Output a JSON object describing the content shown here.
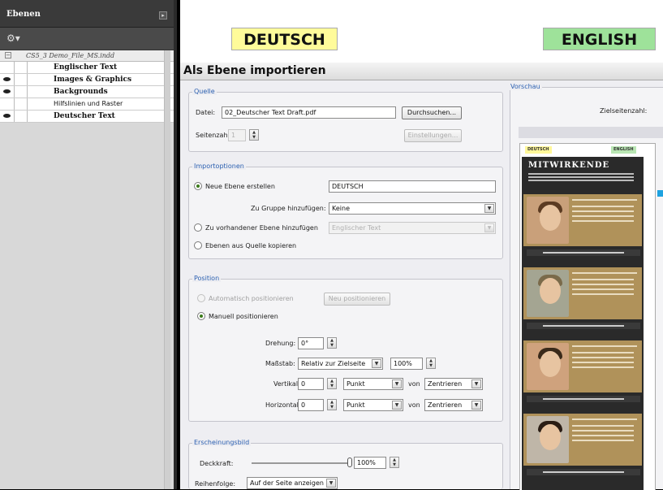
{
  "layers_panel": {
    "title": "Ebenen",
    "menu_glyph": "▸",
    "tool_glyph": "⚙▾",
    "file_collapse_glyph": "−",
    "file": "CS5_3 Demo_File_MS.indd",
    "layers": [
      {
        "name": "Englischer Text",
        "visible": false
      },
      {
        "name": "Images & Graphics",
        "visible": true
      },
      {
        "name": "Backgrounds",
        "visible": true
      },
      {
        "name": "Hilfslinien und Raster",
        "visible": false
      },
      {
        "name": "Deutscher Text",
        "visible": true
      }
    ]
  },
  "banner": {
    "de": "DEUTSCH",
    "en": "ENGLISH"
  },
  "dialog": {
    "title": "Als Ebene importieren",
    "quelle": {
      "legend": "Quelle",
      "datei_label": "Datei:",
      "datei_value": "02_Deutscher Text Draft.pdf",
      "browse_button": "Durchsuchen...",
      "seitenzahl_label": "Seitenzahl:",
      "seitenzahl_value": "1",
      "settings_button": "Einstellungen..."
    },
    "import": {
      "legend": "Importoptionen",
      "new_layer_label": "Neue Ebene erstellen",
      "new_layer_value": "DEUTSCH",
      "group_label": "Zu Gruppe hinzufügen:",
      "group_value": "Keine",
      "existing_label": "Zu vorhandener Ebene hinzufügen",
      "existing_value": "Englischer Text",
      "copy_label": "Ebenen aus Quelle kopieren"
    },
    "position": {
      "legend": "Position",
      "auto_label": "Automatisch positionieren",
      "auto_button": "Neu positionieren",
      "manual_label": "Manuell positionieren",
      "rotation_label": "Drehung:",
      "rotation_value": "0°",
      "scale_label": "Maßstab:",
      "scale_mode": "Relativ zur Zielseite",
      "scale_value": "100%",
      "vertical_label": "Vertikal:",
      "vertical_value": "0",
      "vertical_unit": "Punkt",
      "vertical_von": "von",
      "vertical_ref": "Zentrieren",
      "horizontal_label": "Horizontal:",
      "horizontal_value": "0",
      "horizontal_unit": "Punkt",
      "horizontal_von": "von",
      "horizontal_ref": "Zentrieren"
    },
    "appearance": {
      "legend": "Erscheinungsbild",
      "opacity_label": "Deckkraft:",
      "opacity_value": "100%",
      "opacity_level": 1.0,
      "order_label": "Reihenfolge:",
      "order_value": "Auf der Seite anzeigen"
    },
    "preview": {
      "legend": "Vorschau",
      "target_page_label": "Zielseitenzahl:",
      "doc_tag_de": "DEUTSCH",
      "doc_tag_en": "ENGLISH",
      "doc_heading": "MITWIRKENDE"
    }
  }
}
